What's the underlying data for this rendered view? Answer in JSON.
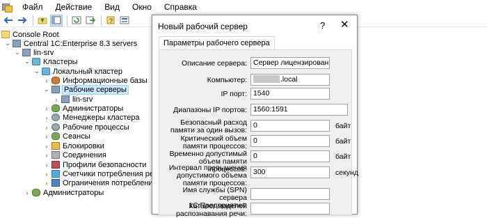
{
  "menu": {
    "items": [
      "Файл",
      "Действие",
      "Вид",
      "Окно",
      "Справка"
    ]
  },
  "toolbar": {
    "buttons": [
      "back-icon",
      "forward-icon",
      "up-folder-icon",
      "show-tree-icon",
      "refresh-icon",
      "export-icon",
      "help-icon",
      "properties-icon"
    ]
  },
  "tree": {
    "root": "Console Root",
    "central": "Central 1C:Enterprise 8.3 servers",
    "host": "lin-srv",
    "clusters": "Кластеры",
    "local_cluster": "Локальный кластер",
    "info_bases": "Информационные базы",
    "work_servers": "Рабочие серверы",
    "work_server_host": "lin-srv",
    "admins": "Администраторы",
    "cluster_managers": "Менеджеры кластера",
    "work_processes": "Рабочие процессы",
    "sessions": "Сеансы",
    "locks": "Блокировки",
    "connections": "Соединения",
    "security_profiles": "Профили безопасности",
    "consumption_counters": "Счетчики потребления ресур",
    "consumption_limits": "Ограничения потребления ре",
    "root_admins": "Администраторы"
  },
  "dialog": {
    "title": "Новый рабочий сервер",
    "help": "?",
    "close": "✕",
    "tab": "Параметры рабочего сервера",
    "fields": {
      "description_label": "Описание сервера:",
      "description_value": "Сервер лицензирования",
      "computer_label": "Компьютер:",
      "computer_value": ".local",
      "ip_port_label": "IP порт:",
      "ip_port_value": "1540",
      "ip_range_label": "Диапазоны IP портов:",
      "ip_range_value": "1560:1591",
      "safe_memory_label": "Безопасный расход памяти за один вызов:",
      "safe_memory_value": "0",
      "safe_memory_unit": "байт",
      "critical_memory_label": "Критический объем памяти процессов:",
      "critical_memory_value": "0",
      "critical_memory_unit": "байт",
      "temp_memory_label": "Временно допустимый объем памяти процессов:",
      "temp_memory_value": "0",
      "temp_memory_unit": "байт",
      "interval_label": "Интервал превышения допустимого объема памяти процессов:",
      "interval_value": "300",
      "interval_unit": "секунд",
      "spn_label": "Имя службы (SPN) сервера 1С:Предприятия:",
      "spn_value": "",
      "speech_label": "Каталог моделей распознавания речи:",
      "speech_value": ""
    }
  }
}
